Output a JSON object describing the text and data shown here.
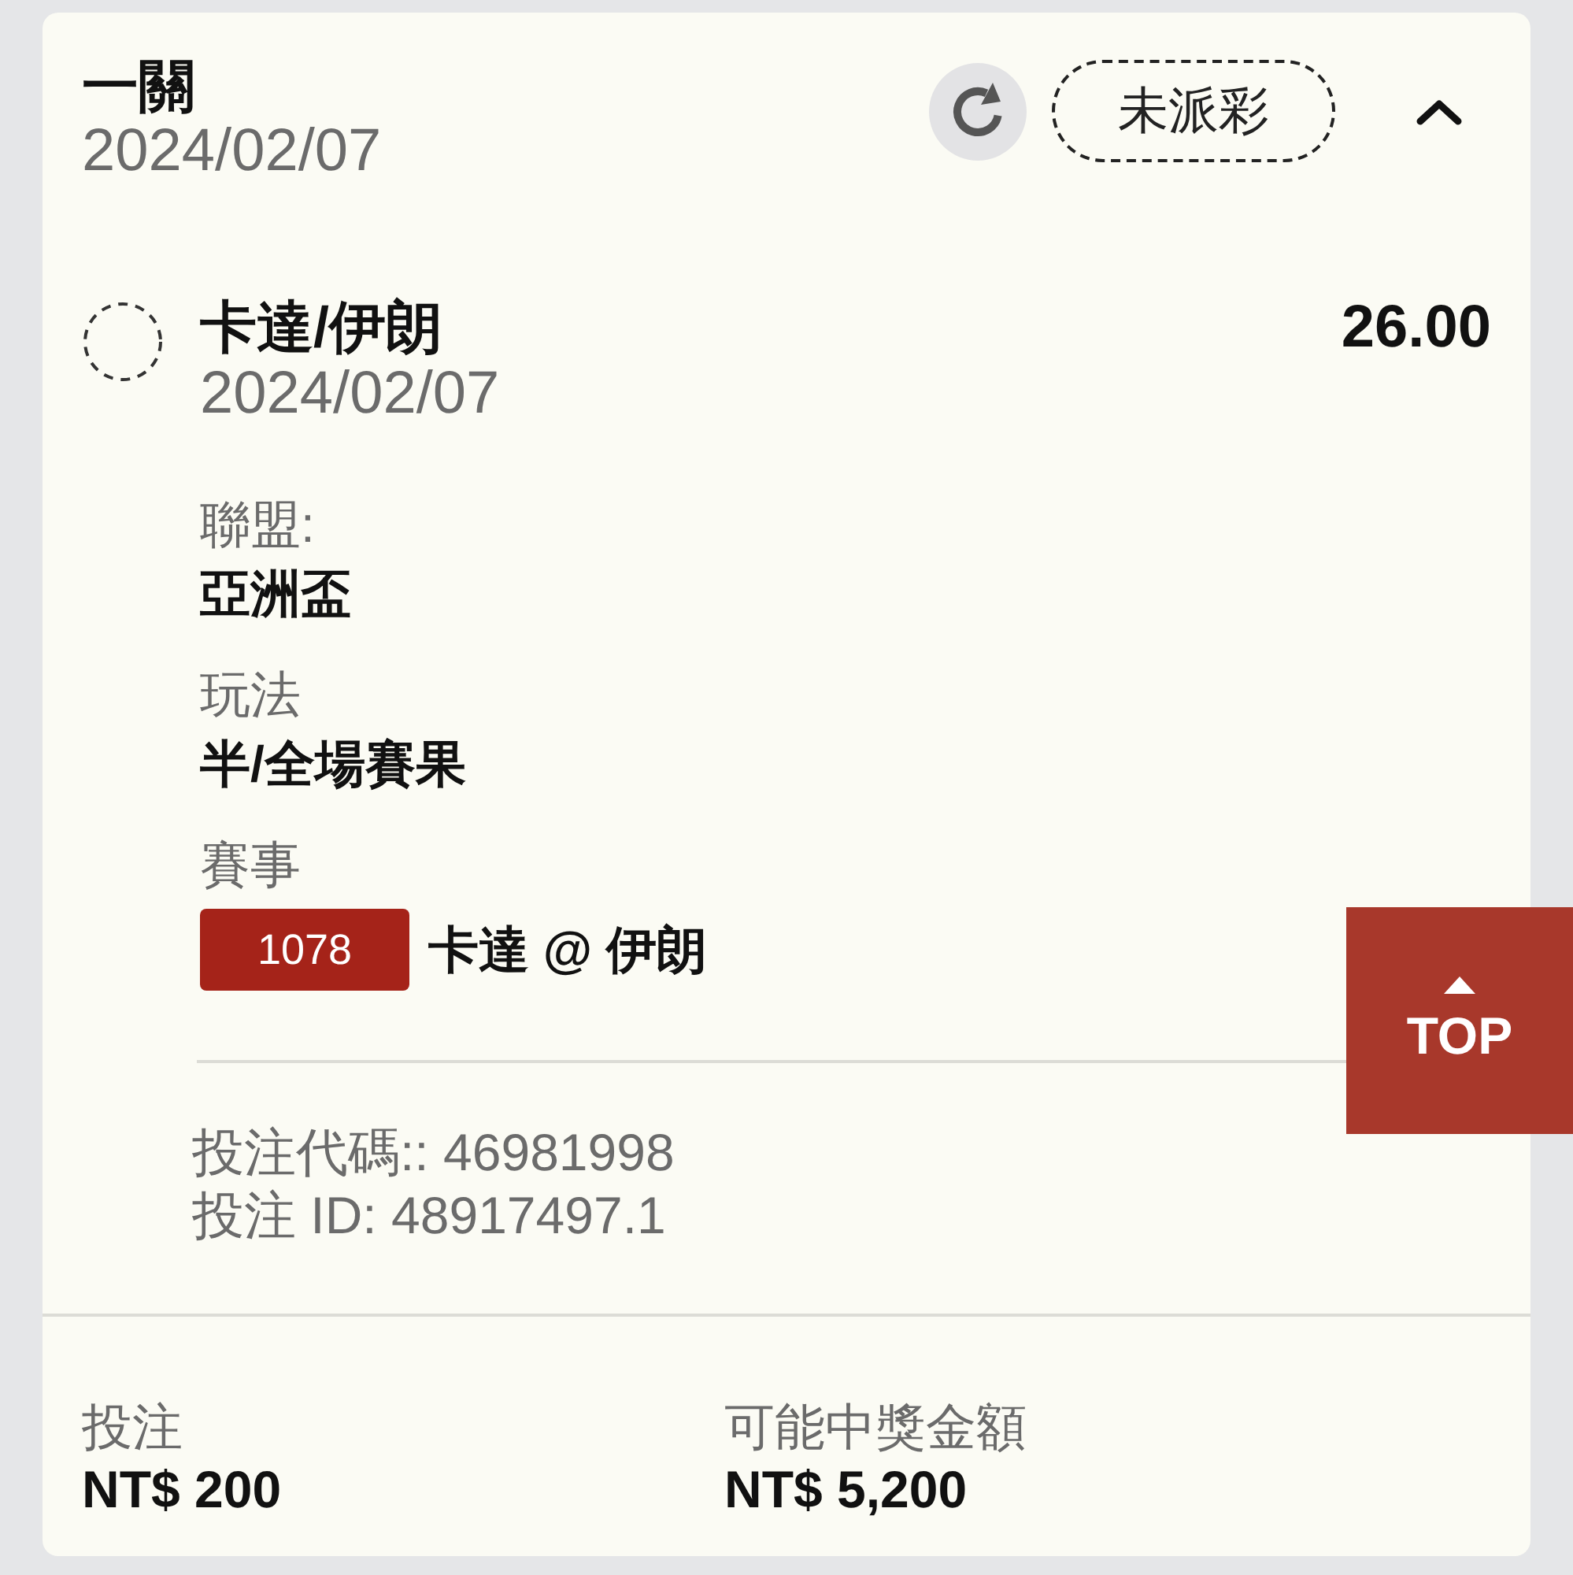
{
  "bet": {
    "type": "一關",
    "date": "2024/02/07",
    "status": "未派彩",
    "expanded": true
  },
  "selection": {
    "title": "卡達/伊朗",
    "date": "2024/02/07",
    "odds": "26.00"
  },
  "details": [
    {
      "kind": "text",
      "label": "聯盟:",
      "value": "亞洲盃"
    },
    {
      "kind": "text",
      "label": "玩法",
      "value": "半/全場賽果"
    },
    {
      "kind": "match",
      "label": "賽事",
      "code": "1078",
      "value": "卡達 @ 伊朗"
    }
  ],
  "references": [
    "投注代碼:: 46981998",
    "投注 ID: 48917497.1"
  ],
  "totals": [
    {
      "label": "投注",
      "value": "NT$ 200"
    },
    {
      "label": "可能中獎金額",
      "value": "NT$ 5,200"
    }
  ],
  "top_button": {
    "label": "TOP"
  }
}
